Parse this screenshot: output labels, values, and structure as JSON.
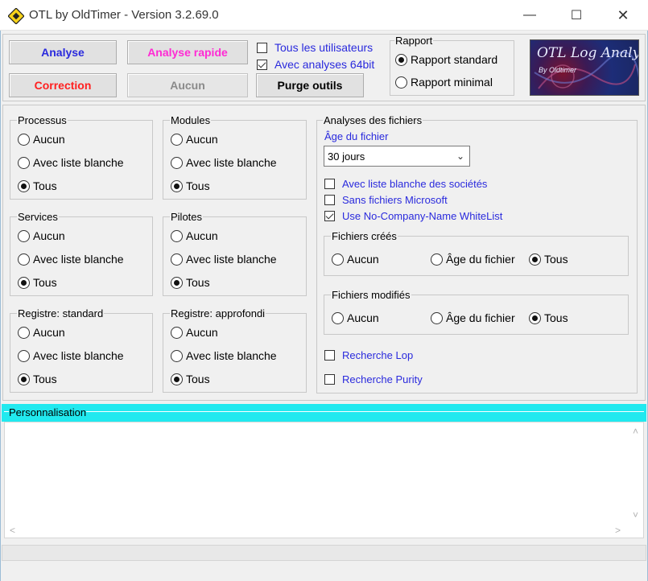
{
  "window": {
    "title": "OTL by OldTimer - Version 3.2.69.0"
  },
  "toolbar": {
    "analyse": "Analyse",
    "analyse_rapide": "Analyse rapide",
    "correction": "Correction",
    "aucun": "Aucun",
    "purge": "Purge outils",
    "tous_utilisateurs": "Tous les utilisateurs",
    "avec_64bit": "Avec analyses 64bit"
  },
  "rapport": {
    "label": "Rapport",
    "standard": "Rapport standard",
    "minimal": "Rapport minimal"
  },
  "logo": {
    "title": "OTL Log Analysis",
    "subtitle": "By Oldtimer"
  },
  "groups": {
    "processus": {
      "label": "Processus",
      "opts": [
        "Aucun",
        "Avec liste blanche",
        "Tous"
      ]
    },
    "modules": {
      "label": "Modules",
      "opts": [
        "Aucun",
        "Avec liste blanche",
        "Tous"
      ]
    },
    "services": {
      "label": "Services",
      "opts": [
        "Aucun",
        "Avec liste blanche",
        "Tous"
      ]
    },
    "pilotes": {
      "label": "Pilotes",
      "opts": [
        "Aucun",
        "Avec liste blanche",
        "Tous"
      ]
    },
    "reg_standard": {
      "label": "Registre: standard",
      "opts": [
        "Aucun",
        "Avec liste blanche",
        "Tous"
      ]
    },
    "reg_approfondi": {
      "label": "Registre: approfondi",
      "opts": [
        "Aucun",
        "Avec liste blanche",
        "Tous"
      ]
    }
  },
  "files": {
    "label": "Analyses des fichiers",
    "age_label": "Âge du fichier",
    "age_value": "30 jours",
    "whitelist_societes": "Avec liste blanche des sociétés",
    "sans_microsoft": "Sans fichiers Microsoft",
    "no_company": "Use No-Company-Name WhiteList",
    "crees": {
      "label": "Fichiers créés",
      "opts": [
        "Aucun",
        "Âge du fichier",
        "Tous"
      ]
    },
    "modifies": {
      "label": "Fichiers modifiés",
      "opts": [
        "Aucun",
        "Âge du fichier",
        "Tous"
      ]
    },
    "lop": "Recherche Lop",
    "purity": "Recherche Purity"
  },
  "perso": {
    "label": "Personnalisation"
  }
}
